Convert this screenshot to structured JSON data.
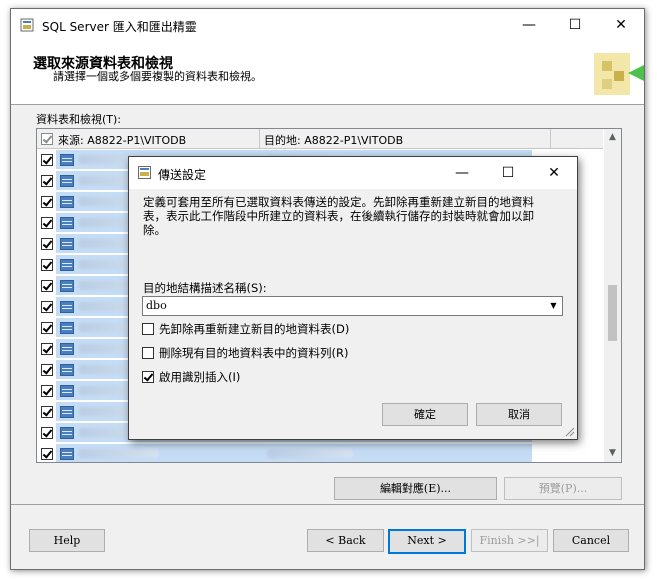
{
  "window": {
    "title": "SQL Server 匯入和匯出精靈",
    "controls": [
      "minimize-icon",
      "maximize-icon",
      "close-icon"
    ]
  },
  "header": {
    "title": "選取來源資料表和檢視",
    "subtitle": "請選擇一個或多個要複製的資料表和檢視。"
  },
  "grid": {
    "label": "資料表和檢視(T):",
    "columns": [
      "來源: A8822-P1\\VITODB",
      "目的地: A8822-P1\\VITODB"
    ],
    "header_checked": true,
    "rows": [
      {
        "checked": true
      },
      {
        "checked": true
      },
      {
        "checked": true
      },
      {
        "checked": true
      },
      {
        "checked": true
      },
      {
        "checked": true
      },
      {
        "checked": true
      },
      {
        "checked": true
      },
      {
        "checked": true
      },
      {
        "checked": true
      },
      {
        "checked": true
      },
      {
        "checked": true
      },
      {
        "checked": true
      },
      {
        "checked": true
      },
      {
        "checked": true
      }
    ]
  },
  "buttons": {
    "edit_mappings": "編輯對應(E)...",
    "preview": "預覽(P)...",
    "help": "Help",
    "back": "< Back",
    "next": "Next >",
    "finish": "Finish >>|",
    "cancel": "Cancel"
  },
  "dialog": {
    "title": "傳送設定",
    "description": "定義可套用至所有已選取資料表傳送的設定。先卸除再重新建立新目的地資料表，表示此工作階段中所建立的資料表，在後續執行儲存的封裝時就會加以卸除。",
    "schema_label": "目的地結構描述名稱(S):",
    "schema_value": "dbo",
    "options": [
      {
        "label": "先卸除再重新建立新目的地資料表(D)",
        "checked": false
      },
      {
        "label": "刪除現有目的地資料表中的資料列(R)",
        "checked": false
      },
      {
        "label": "啟用識別插入(I)",
        "checked": true
      }
    ],
    "ok": "確定",
    "cancel": "取消"
  }
}
